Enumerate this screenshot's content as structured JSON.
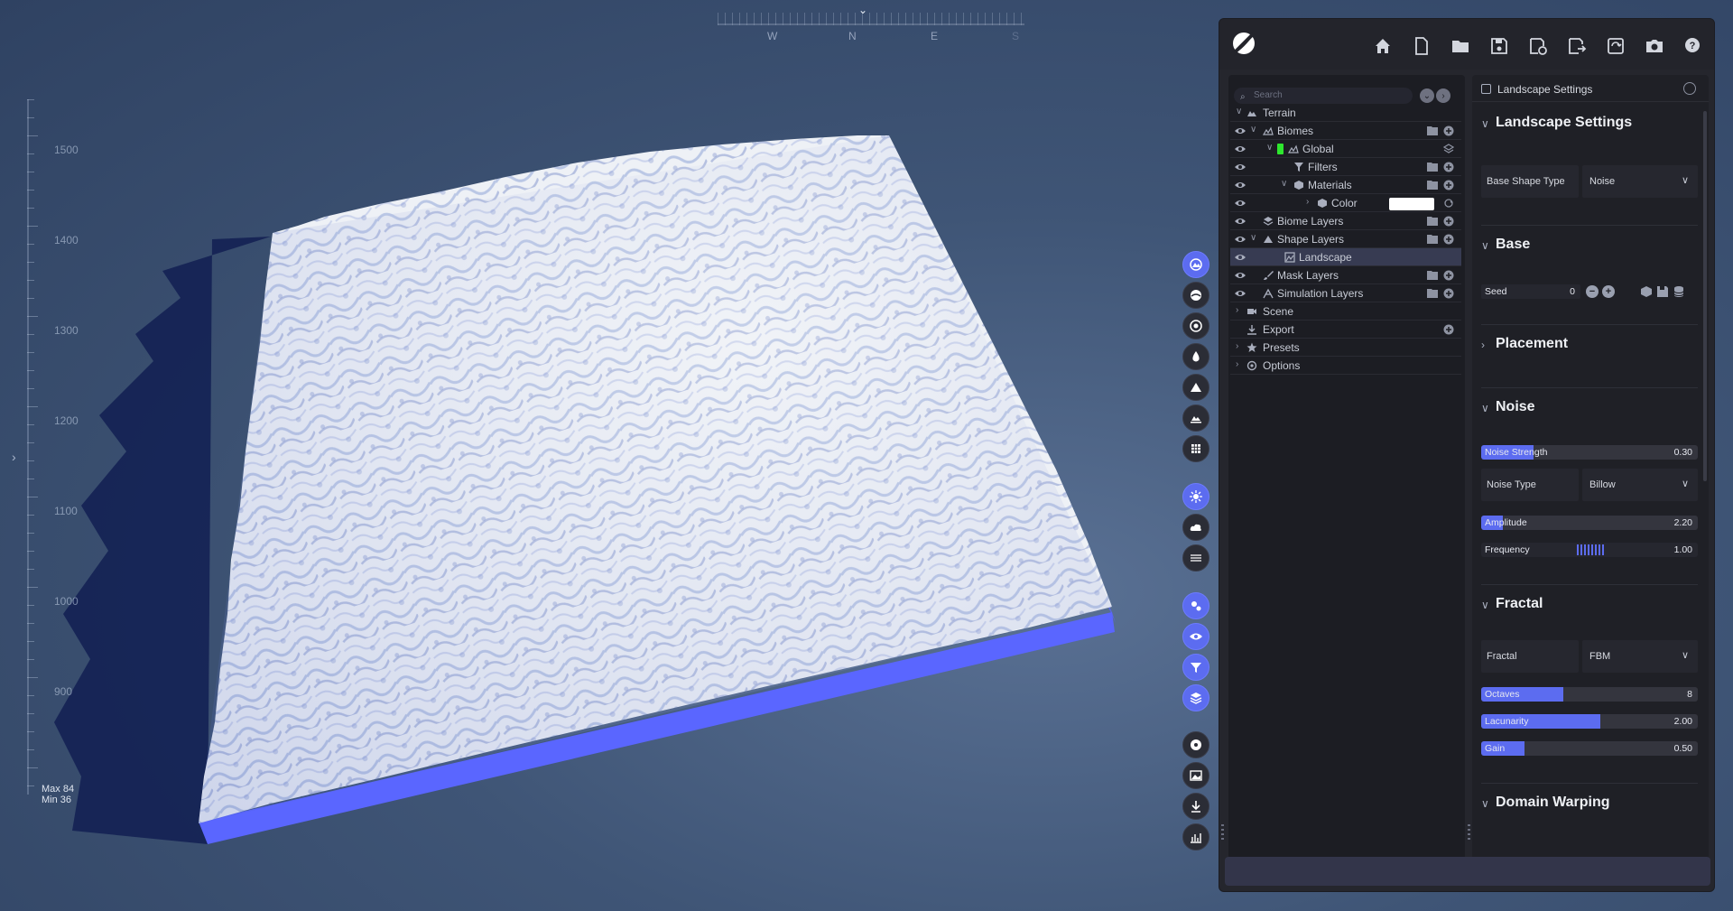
{
  "viewport": {
    "compass": {
      "letters": [
        "W",
        "N",
        "E",
        "S"
      ]
    },
    "ruler": {
      "labels": [
        "1500",
        "1400",
        "1300",
        "1200",
        "1100",
        "1000",
        "900"
      ]
    },
    "max_label": "Max 84",
    "min_label": "Min 36",
    "colors": {
      "terrain": "#e9ecf2",
      "skirt": "#5a66ff",
      "background": "#3f5576"
    }
  },
  "toolbar": {
    "groups": [
      [
        "landscape-icon",
        "biome-icon",
        "globe-icon",
        "water-drop-icon",
        "mountain-icon",
        "terrain-layers-icon",
        "grid-icon"
      ],
      [
        "sun-icon",
        "weather-icon",
        "layers-lines-icon"
      ],
      [
        "settings-icon",
        "eye-icon",
        "filter-icon",
        "stack-icon"
      ],
      [
        "record-icon",
        "image-icon",
        "download-icon",
        "stats-icon"
      ]
    ]
  },
  "topbar": {
    "buttons": [
      "home-icon",
      "new-file-icon",
      "open-folder-icon",
      "save-icon",
      "save-as-icon",
      "export-file-icon",
      "refresh-icon",
      "camera-icon",
      "help-icon"
    ]
  },
  "outliner": {
    "search_placeholder": "Search",
    "items": [
      {
        "label": "Terrain"
      },
      {
        "label": "Biomes"
      },
      {
        "label": "Global"
      },
      {
        "label": "Filters"
      },
      {
        "label": "Materials"
      },
      {
        "label": "Color"
      },
      {
        "label": "Biome Layers"
      },
      {
        "label": "Shape Layers"
      },
      {
        "label": "Landscape"
      },
      {
        "label": "Mask Layers"
      },
      {
        "label": "Simulation Layers"
      },
      {
        "label": "Scene"
      },
      {
        "label": "Export"
      },
      {
        "label": "Presets"
      },
      {
        "label": "Options"
      }
    ]
  },
  "properties": {
    "header": "Landscape Settings",
    "landscape_settings": {
      "title": "Landscape Settings",
      "base_shape_label": "Base Shape Type",
      "base_shape_value": "Noise"
    },
    "base": {
      "title": "Base",
      "seed_label": "Seed",
      "seed_value": "0"
    },
    "placement": {
      "title": "Placement"
    },
    "noise": {
      "title": "Noise",
      "strength_label": "Noise Strength",
      "strength_value": "0.30",
      "strength_level": 0.24,
      "type_label": "Noise Type",
      "type_value": "Billow",
      "amplitude_label": "Amplitude",
      "amplitude_value": "2.20",
      "amplitude_level": 0.1,
      "frequency_label": "Frequency",
      "frequency_value": "1.00"
    },
    "fractal": {
      "title": "Fractal",
      "fractal_label": "Fractal",
      "fractal_value": "FBM",
      "octaves_label": "Octaves",
      "octaves_value": "8",
      "octaves_level": 0.38,
      "lacunarity_label": "Lacunarity",
      "lacunarity_value": "2.00",
      "lacunarity_level": 0.55,
      "gain_label": "Gain",
      "gain_value": "0.50",
      "gain_level": 0.2
    },
    "domain_warping": {
      "title": "Domain Warping"
    }
  }
}
